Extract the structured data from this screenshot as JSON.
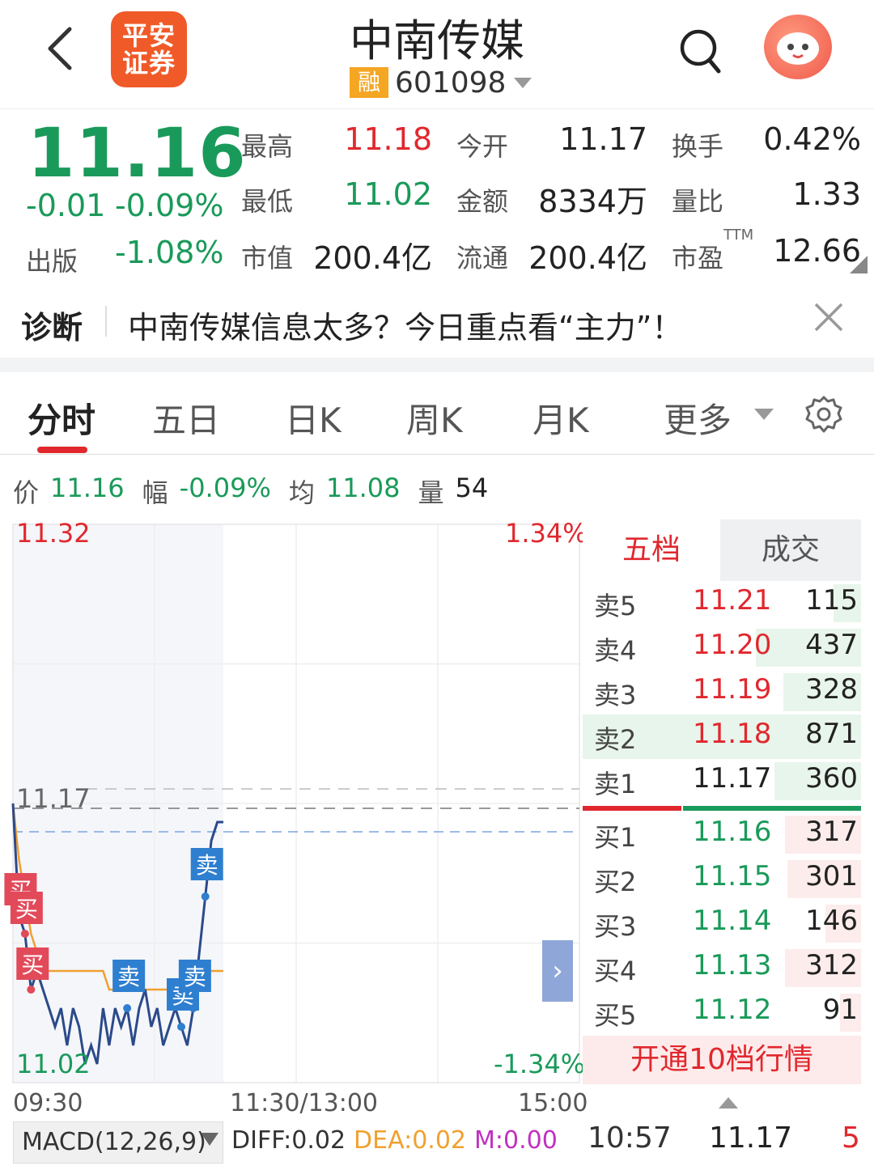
{
  "header": {
    "broker_logo_line1": "平安",
    "broker_logo_line2": "证券",
    "stock_name": "中南传媒",
    "margin_badge": "融",
    "stock_code": "601098"
  },
  "quote": {
    "price": "11.16",
    "change": "-0.01",
    "change_pct": "-0.09%",
    "sector_label": "出版",
    "sector_change": "-1.08%",
    "stats": [
      {
        "label": "最高",
        "value": "11.18",
        "color": "red"
      },
      {
        "label": "今开",
        "value": "11.17",
        "color": "dark"
      },
      {
        "label": "换手",
        "value": "0.42%",
        "color": "dark"
      },
      {
        "label": "最低",
        "value": "11.02",
        "color": "green"
      },
      {
        "label": "金额",
        "value": "8334万",
        "color": "dark"
      },
      {
        "label": "量比",
        "value": "1.33",
        "color": "dark"
      },
      {
        "label": "市值",
        "value": "200.4亿",
        "color": "dark"
      },
      {
        "label": "流通",
        "value": "200.4亿",
        "color": "dark"
      },
      {
        "label": "市盈",
        "value": "12.66",
        "color": "dark"
      }
    ],
    "ttm_label": "TTM"
  },
  "diagnosis": {
    "tag": "诊断",
    "text": "中南传媒信息太多？今日重点看“主力”！"
  },
  "tabs": [
    "分时",
    "五日",
    "日K",
    "周K",
    "月K",
    "更多"
  ],
  "info_row": {
    "price_label": "价",
    "price": "11.16",
    "amp_label": "幅",
    "amp": "-0.09%",
    "avg_label": "均",
    "avg": "11.08",
    "vol_label": "量",
    "vol": "54"
  },
  "chart_data": {
    "type": "line",
    "title": "",
    "y_high": "11.32",
    "y_low": "11.02",
    "y_ref": "11.17",
    "pct_high": "1.34%",
    "pct_low": "-1.34%",
    "x_labels": [
      "09:30",
      "11:30/13:00",
      "15:00"
    ],
    "ylim": [
      11.02,
      11.32
    ],
    "series": [
      {
        "values": [
          11.17,
          11.11,
          11.1,
          11.07,
          11.08,
          11.07,
          11.06,
          11.05,
          11.06,
          11.04,
          11.06,
          11.05,
          11.03,
          11.04,
          11.03,
          11.06,
          11.04,
          11.06,
          11.05,
          11.06,
          11.04,
          11.06,
          11.07,
          11.05,
          11.06,
          11.04,
          11.05,
          11.06,
          11.05,
          11.04,
          11.06,
          11.09,
          11.12,
          11.15,
          11.16,
          11.16
        ]
      },
      {
        "values": [
          11.17,
          11.14,
          11.12,
          11.1,
          11.09,
          11.08,
          11.08,
          11.08,
          11.08,
          11.08,
          11.08,
          11.08,
          11.08,
          11.08,
          11.08,
          11.08,
          11.07,
          11.07,
          11.07,
          11.07,
          11.07,
          11.07,
          11.07,
          11.07,
          11.07,
          11.07,
          11.07,
          11.07,
          11.07,
          11.07,
          11.08,
          11.08,
          11.08,
          11.08,
          11.08,
          11.08
        ]
      }
    ],
    "markers": [
      {
        "label": "买",
        "kind": "buy"
      },
      {
        "label": "买",
        "kind": "buy"
      },
      {
        "label": "买",
        "kind": "buy"
      },
      {
        "label": "卖",
        "kind": "sell"
      },
      {
        "label": "卖",
        "kind": "sell"
      },
      {
        "label": "卖",
        "kind": "sell"
      },
      {
        "label": "卖",
        "kind": "sell"
      }
    ]
  },
  "order_book": {
    "tab_active": "五档",
    "tab_other": "成交",
    "asks": [
      {
        "label": "卖5",
        "price": "11.21",
        "vol": "115",
        "fill": 0.13
      },
      {
        "label": "卖4",
        "price": "11.20",
        "vol": "437",
        "fill": 0.5
      },
      {
        "label": "卖3",
        "price": "11.19",
        "vol": "328",
        "fill": 0.37
      },
      {
        "label": "卖2",
        "price": "11.18",
        "vol": "871",
        "fill": 1.0
      },
      {
        "label": "卖1",
        "price": "11.17",
        "vol": "360",
        "fill": 0.41
      }
    ],
    "bids": [
      {
        "label": "买1",
        "price": "11.16",
        "vol": "317",
        "fill": 0.36
      },
      {
        "label": "买2",
        "price": "11.15",
        "vol": "301",
        "fill": 0.35
      },
      {
        "label": "买3",
        "price": "11.14",
        "vol": "146",
        "fill": 0.17
      },
      {
        "label": "买4",
        "price": "11.13",
        "vol": "312",
        "fill": 0.36
      },
      {
        "label": "买5",
        "price": "11.12",
        "vol": "91",
        "fill": 0.1
      }
    ],
    "upgrade_label": "开通10档行情"
  },
  "bottom": {
    "macd_label": "MACD(12,26,9)",
    "diff": "DIFF:0.02",
    "dea": "DEA:0.02",
    "m": "M:0.00",
    "tick_time": "10:57",
    "tick_price": "11.17",
    "tick_vol": "5"
  },
  "colors": {
    "up": "#e0282e",
    "down": "#1a9a5a",
    "price_line": "#2b4a8a",
    "avg_line": "#f0a030",
    "sell_marker": "#2f7fd0",
    "buy_marker": "#e24a5a"
  }
}
